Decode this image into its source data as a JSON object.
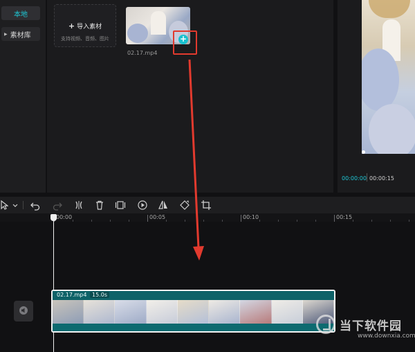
{
  "sidebar": {
    "items": [
      {
        "label": "本地"
      },
      {
        "label": "素材库"
      }
    ]
  },
  "media": {
    "import_card": {
      "title": "导入素材",
      "subtitle": "支持视频、音频、图片"
    },
    "items": [
      {
        "filename": "02.17.mp4",
        "add_icon": "plus-icon"
      }
    ]
  },
  "preview": {
    "current_time": "00:00:00",
    "total_time": "00:00:15"
  },
  "toolbar": {
    "tools": [
      "select-arrow-icon",
      "undo-icon",
      "redo-icon",
      "split-icon",
      "delete-icon",
      "freeze-frame-icon",
      "play-reverse-icon",
      "mirror-icon",
      "rotate-icon",
      "crop-icon"
    ]
  },
  "timeline": {
    "ruler_labels": [
      "00:00",
      "00:05",
      "00:10",
      "00:15"
    ],
    "clip": {
      "name": "02.17.mp4",
      "duration": "15.0s"
    }
  },
  "watermark": {
    "cn": "当下软件园",
    "en": "www.downxia.com"
  },
  "colors": {
    "accent": "#1ec8d6",
    "annotation_red": "#e23a2e",
    "clip_teal": "#0e6268",
    "background": "#111113"
  }
}
